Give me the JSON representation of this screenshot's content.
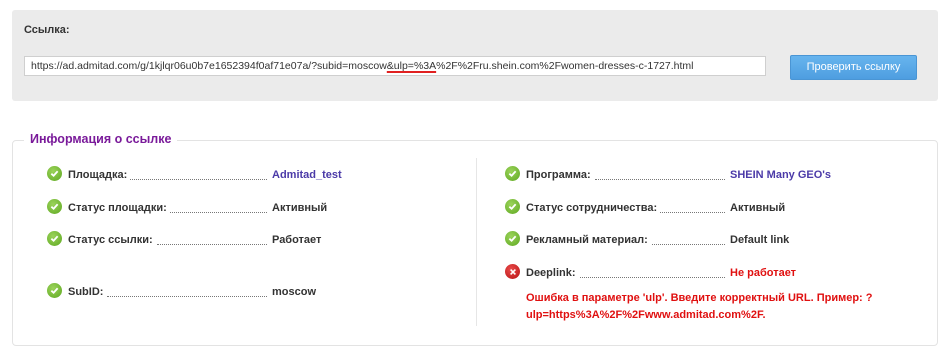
{
  "check": {
    "label": "Ссылка:",
    "url_before": "https://ad.admitad.com/g/1kjlqr06u0b7e1652394f0af71e07a/?subid=moscow",
    "url_highlight": "&ulp=%3A",
    "url_after": "%2F%2Fru.shein.com%2Fwomen-dresses-c-1727.html",
    "button_label": "Проверить ссылку"
  },
  "info": {
    "title": "Информация о ссылке",
    "left": [
      {
        "label": "Площадка:",
        "value": "Admitad_test",
        "status": "ok"
      },
      {
        "label": "Статус площадки:",
        "value": "Активный",
        "status": "ok"
      },
      {
        "label": "Статус ссылки:",
        "value": "Работает",
        "status": "ok"
      },
      {
        "label": "SubID:",
        "value": "moscow",
        "status": "ok"
      }
    ],
    "right": [
      {
        "label": "Программа:",
        "value": "SHEIN Many GEO's",
        "status": "ok"
      },
      {
        "label": "Статус сотрудничества:",
        "value": "Активный",
        "status": "ok"
      },
      {
        "label": "Рекламный материал:",
        "value": "Default link",
        "status": "ok"
      },
      {
        "label": "Deeplink:",
        "value": "Не работает",
        "status": "error"
      }
    ],
    "error_message": "Ошибка в параметре 'ulp'. Введите корректный URL. Пример: ?ulp=https%3A%2F%2Fwww.admitad.com%2F."
  },
  "icons": {
    "ok": "check-circle-icon",
    "error": "x-circle-icon"
  },
  "colors": {
    "accent_title": "#7a1a9a",
    "link_value": "#4b3aa8",
    "error": "#e01010",
    "button": "#5aa8e8"
  }
}
